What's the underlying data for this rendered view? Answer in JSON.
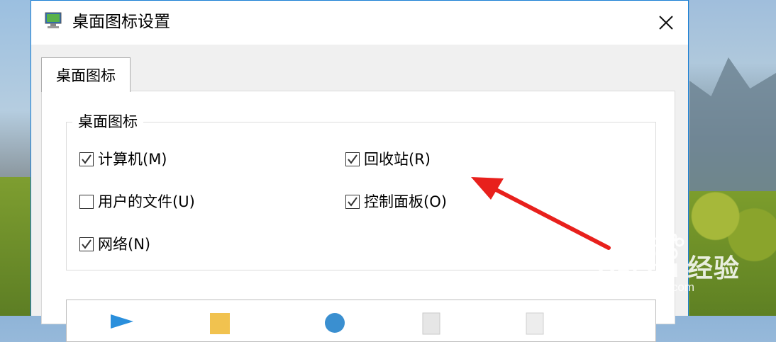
{
  "window": {
    "title": "桌面图标设置",
    "close_glyph": "✕"
  },
  "tabs": [
    {
      "label": "桌面图标",
      "selected": true
    }
  ],
  "group": {
    "legend": "桌面图标",
    "items": [
      {
        "label": "计算机(M)",
        "checked": true
      },
      {
        "label": "回收站(R)",
        "checked": true
      },
      {
        "label": "用户的文件(U)",
        "checked": false
      },
      {
        "label": "控制面板(O)",
        "checked": true
      },
      {
        "label": "网络(N)",
        "checked": true
      }
    ]
  },
  "preview_icons": [
    "computer-icon",
    "user-folder-icon",
    "network-icon",
    "recycle-bin-full-icon",
    "recycle-bin-empty-icon"
  ],
  "annotation": {
    "arrow_color": "#e8201c"
  },
  "watermark": {
    "logo_text": "Bai du 经验",
    "url": "jingyan.baidu.com"
  },
  "colors": {
    "accent": "#1a7fd4",
    "check": "#333333"
  }
}
